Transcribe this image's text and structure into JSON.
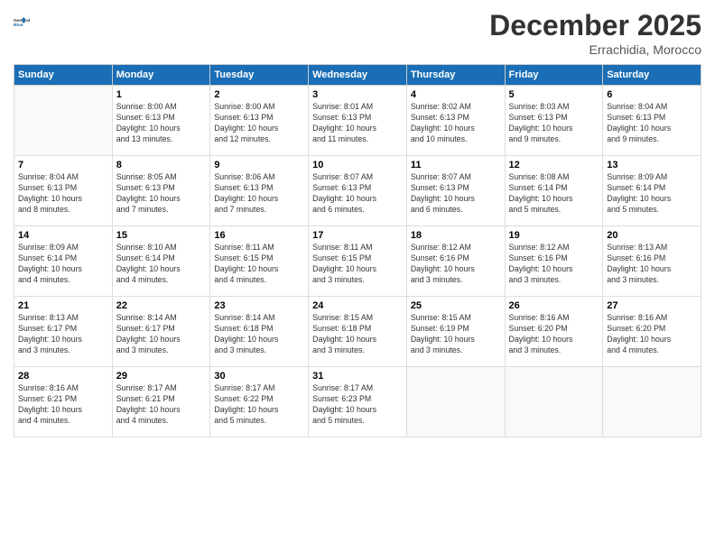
{
  "logo": {
    "line1": "General",
    "line2": "Blue"
  },
  "title": "December 2025",
  "subtitle": "Errachidia, Morocco",
  "header_days": [
    "Sunday",
    "Monday",
    "Tuesday",
    "Wednesday",
    "Thursday",
    "Friday",
    "Saturday"
  ],
  "weeks": [
    [
      {
        "day": "",
        "info": ""
      },
      {
        "day": "1",
        "info": "Sunrise: 8:00 AM\nSunset: 6:13 PM\nDaylight: 10 hours\nand 13 minutes."
      },
      {
        "day": "2",
        "info": "Sunrise: 8:00 AM\nSunset: 6:13 PM\nDaylight: 10 hours\nand 12 minutes."
      },
      {
        "day": "3",
        "info": "Sunrise: 8:01 AM\nSunset: 6:13 PM\nDaylight: 10 hours\nand 11 minutes."
      },
      {
        "day": "4",
        "info": "Sunrise: 8:02 AM\nSunset: 6:13 PM\nDaylight: 10 hours\nand 10 minutes."
      },
      {
        "day": "5",
        "info": "Sunrise: 8:03 AM\nSunset: 6:13 PM\nDaylight: 10 hours\nand 9 minutes."
      },
      {
        "day": "6",
        "info": "Sunrise: 8:04 AM\nSunset: 6:13 PM\nDaylight: 10 hours\nand 9 minutes."
      }
    ],
    [
      {
        "day": "7",
        "info": "Sunrise: 8:04 AM\nSunset: 6:13 PM\nDaylight: 10 hours\nand 8 minutes."
      },
      {
        "day": "8",
        "info": "Sunrise: 8:05 AM\nSunset: 6:13 PM\nDaylight: 10 hours\nand 7 minutes."
      },
      {
        "day": "9",
        "info": "Sunrise: 8:06 AM\nSunset: 6:13 PM\nDaylight: 10 hours\nand 7 minutes."
      },
      {
        "day": "10",
        "info": "Sunrise: 8:07 AM\nSunset: 6:13 PM\nDaylight: 10 hours\nand 6 minutes."
      },
      {
        "day": "11",
        "info": "Sunrise: 8:07 AM\nSunset: 6:13 PM\nDaylight: 10 hours\nand 6 minutes."
      },
      {
        "day": "12",
        "info": "Sunrise: 8:08 AM\nSunset: 6:14 PM\nDaylight: 10 hours\nand 5 minutes."
      },
      {
        "day": "13",
        "info": "Sunrise: 8:09 AM\nSunset: 6:14 PM\nDaylight: 10 hours\nand 5 minutes."
      }
    ],
    [
      {
        "day": "14",
        "info": "Sunrise: 8:09 AM\nSunset: 6:14 PM\nDaylight: 10 hours\nand 4 minutes."
      },
      {
        "day": "15",
        "info": "Sunrise: 8:10 AM\nSunset: 6:14 PM\nDaylight: 10 hours\nand 4 minutes."
      },
      {
        "day": "16",
        "info": "Sunrise: 8:11 AM\nSunset: 6:15 PM\nDaylight: 10 hours\nand 4 minutes."
      },
      {
        "day": "17",
        "info": "Sunrise: 8:11 AM\nSunset: 6:15 PM\nDaylight: 10 hours\nand 3 minutes."
      },
      {
        "day": "18",
        "info": "Sunrise: 8:12 AM\nSunset: 6:16 PM\nDaylight: 10 hours\nand 3 minutes."
      },
      {
        "day": "19",
        "info": "Sunrise: 8:12 AM\nSunset: 6:16 PM\nDaylight: 10 hours\nand 3 minutes."
      },
      {
        "day": "20",
        "info": "Sunrise: 8:13 AM\nSunset: 6:16 PM\nDaylight: 10 hours\nand 3 minutes."
      }
    ],
    [
      {
        "day": "21",
        "info": "Sunrise: 8:13 AM\nSunset: 6:17 PM\nDaylight: 10 hours\nand 3 minutes."
      },
      {
        "day": "22",
        "info": "Sunrise: 8:14 AM\nSunset: 6:17 PM\nDaylight: 10 hours\nand 3 minutes."
      },
      {
        "day": "23",
        "info": "Sunrise: 8:14 AM\nSunset: 6:18 PM\nDaylight: 10 hours\nand 3 minutes."
      },
      {
        "day": "24",
        "info": "Sunrise: 8:15 AM\nSunset: 6:18 PM\nDaylight: 10 hours\nand 3 minutes."
      },
      {
        "day": "25",
        "info": "Sunrise: 8:15 AM\nSunset: 6:19 PM\nDaylight: 10 hours\nand 3 minutes."
      },
      {
        "day": "26",
        "info": "Sunrise: 8:16 AM\nSunset: 6:20 PM\nDaylight: 10 hours\nand 3 minutes."
      },
      {
        "day": "27",
        "info": "Sunrise: 8:16 AM\nSunset: 6:20 PM\nDaylight: 10 hours\nand 4 minutes."
      }
    ],
    [
      {
        "day": "28",
        "info": "Sunrise: 8:16 AM\nSunset: 6:21 PM\nDaylight: 10 hours\nand 4 minutes."
      },
      {
        "day": "29",
        "info": "Sunrise: 8:17 AM\nSunset: 6:21 PM\nDaylight: 10 hours\nand 4 minutes."
      },
      {
        "day": "30",
        "info": "Sunrise: 8:17 AM\nSunset: 6:22 PM\nDaylight: 10 hours\nand 5 minutes."
      },
      {
        "day": "31",
        "info": "Sunrise: 8:17 AM\nSunset: 6:23 PM\nDaylight: 10 hours\nand 5 minutes."
      },
      {
        "day": "",
        "info": ""
      },
      {
        "day": "",
        "info": ""
      },
      {
        "day": "",
        "info": ""
      }
    ]
  ]
}
